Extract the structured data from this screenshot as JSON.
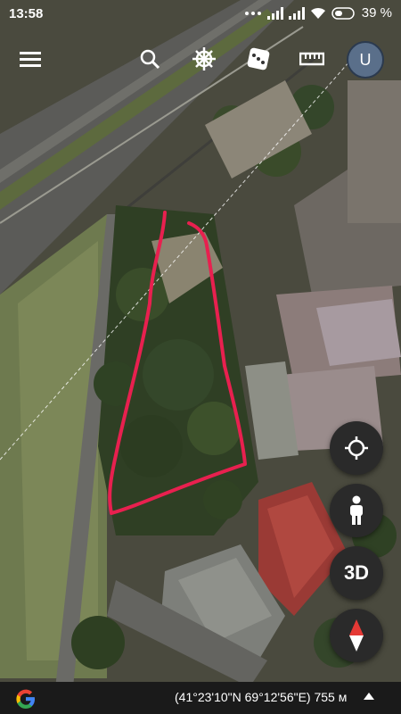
{
  "status": {
    "time": "13:58",
    "battery": "39 %"
  },
  "toolbar": {
    "menu_icon": "menu-icon",
    "search_icon": "search-icon",
    "voyager_icon": "ship-wheel-icon",
    "random_icon": "dice-icon",
    "measure_icon": "ruler-icon",
    "avatar_letter": "U"
  },
  "controls": {
    "threed_label": "3D"
  },
  "footer": {
    "coordinates": "(41°23'10\"N 69°12'56\"E) 755 м"
  },
  "colors": {
    "annotation": "#e8204f",
    "fab_bg": "#2a2a2a"
  }
}
